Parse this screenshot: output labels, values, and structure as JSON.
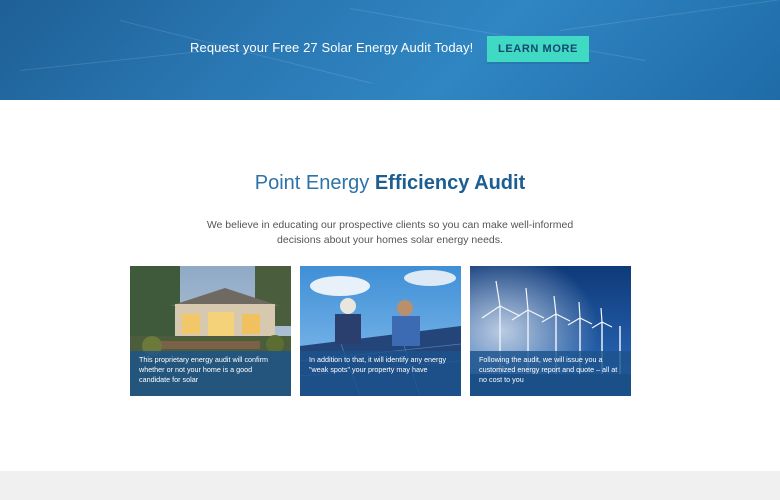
{
  "banner": {
    "text": "Request your Free 27 Solar Energy Audit Today!",
    "cta_label": "LEARN MORE"
  },
  "section": {
    "heading_light": "Point Energy",
    "heading_strong": "Efficiency Audit",
    "intro": "We believe in educating our prospective clients so you can make well-informed decisions about your homes solar energy needs."
  },
  "cards": [
    {
      "caption": "This proprietary energy audit will confirm whether or not your home is a good candidate for solar"
    },
    {
      "caption": "In addition to that, it will identify any energy \"weak spots\" your property may have"
    },
    {
      "caption": "Following the audit, we will issue you a customized energy report and quote – all at no cost to you"
    }
  ],
  "colors": {
    "banner": "#2a78b4",
    "cta": "#3fd9c4",
    "heading": "#2c73a8",
    "caption_overlay": "#1c538c"
  }
}
